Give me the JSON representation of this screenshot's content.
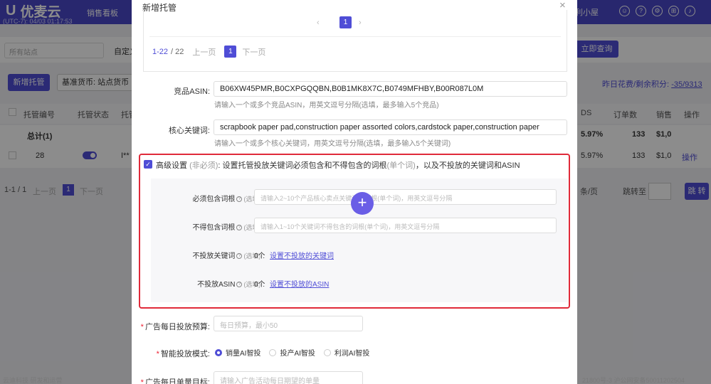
{
  "app": {
    "logo": "优麦云",
    "clock": "(UTC-7): 04/03 01:17:53",
    "nav_item": "销售看板",
    "shop_name": "利小屋",
    "site_select": "所有站点",
    "custom_btn": "自定义",
    "query_btn": "立即查询",
    "new_btn": "新增托管",
    "base_currency_btn": "基准货币: 站点货币",
    "credit_text": "昨日花费/剩余积分:",
    "credit_value": "-35/9313",
    "table": {
      "headers": [
        "托管编号",
        "托管状态",
        "托管",
        "DS",
        "订单数",
        "销售",
        "操作"
      ],
      "total_row": {
        "label": "总计(1)",
        "acos": "5.97%",
        "orders": "133",
        "sales": "$1,0"
      },
      "data_row": {
        "id": "28",
        "name": "I**",
        "acos": "5.97%",
        "orders": "133",
        "sales": "$1,0",
        "action": "操作"
      }
    },
    "pager": {
      "range": "1-1 / 1",
      "prev": "上一页",
      "page": "1",
      "next": "下一页",
      "page_size": "条/页",
      "jump_label": "跳转至",
      "jump_btn": "跳 转"
    },
    "footer_left": "云迪科技 研发和运营",
    "footer_right": "21800号-3    沪公网安备50011202504"
  },
  "modal": {
    "title": "新增托管",
    "close": "×",
    "inner_pager": {
      "page": "1",
      "range": "1-22",
      "total": "/ 22",
      "prev": "上一页",
      "page2": "1",
      "next": "下一页"
    },
    "competitor_asin": {
      "label": "竞品ASIN:",
      "value": "B06XW45PMR,B0CXPGQQBN,B0B1MK8X7C,B0749MFHBY,B00R087L0M",
      "hint": "请输入一个或多个竞品ASIN，用英文逗号分隔(选填，最多输入5个竞品)"
    },
    "core_keywords": {
      "label": "核心关键词:",
      "value": "scrapbook paper pad,construction paper assorted colors,cardstock paper,construction paper",
      "hint": "请输入一个或多个核心关键词，用英文逗号分隔(选填，最多输入5个关键词)"
    },
    "advanced": {
      "title": "高级设置",
      "optional": "(非必须)",
      "desc_a": ": 设置托管投放关键词必须包含和不得包含的词根",
      "desc_b": "(单个词)",
      "desc_c": "，以及不投放的关键词和ASIN",
      "must_include": {
        "label": "必须包含词根",
        "opt": "(选填)",
        "placeholder": "请输入2~10个产品核心卖点关键词的词根(单个词)，用英文逗号分隔"
      },
      "must_exclude": {
        "label": "不得包含词根",
        "opt": "(选填)",
        "placeholder": "请输入1~10个关键词不得包含的词根(单个词)，用英文逗号分隔"
      },
      "neg_keywords": {
        "label": "不投放关键词",
        "opt": "(选填)",
        "count": "0个",
        "link": "设置不投放的关键词"
      },
      "neg_asin": {
        "label": "不投放ASIN",
        "opt": "(选填)",
        "count": "0个",
        "link": "设置不投放的ASIN"
      }
    },
    "daily_budget": {
      "label": "广告每日投放预算:",
      "placeholder": "每日预算，最小50"
    },
    "mode": {
      "label": "智能投放模式:",
      "options": [
        "销量AI智投",
        "投产AI智投",
        "利润AI智投"
      ],
      "selected": "销量AI智投"
    },
    "daily_target": {
      "label": "广告每日单量目标:",
      "placeholder": "请输入广告活动每日期望的单量"
    }
  },
  "colors": {
    "accent": "#4f4dd6",
    "highlight_border": "#e02a3a",
    "fab": "#6a5ee6"
  }
}
